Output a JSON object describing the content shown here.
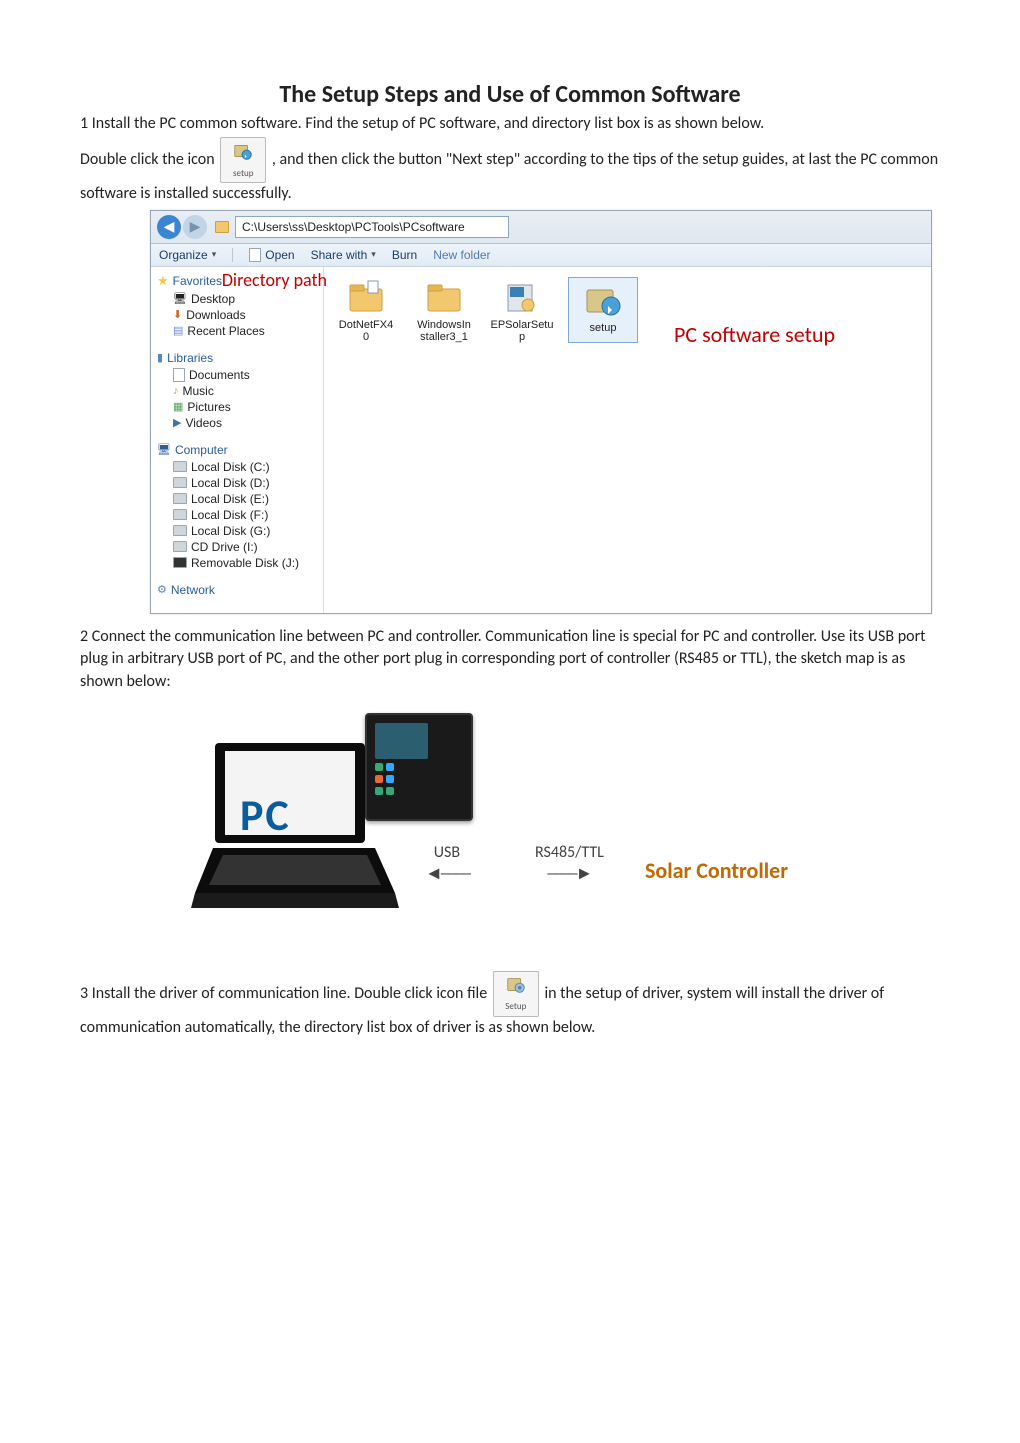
{
  "title": "The Setup Steps and Use of Common Software",
  "paragraphs": {
    "p1": "1 Install the PC common software. Find the setup of PC software, and directory list box is as shown below.",
    "p2_a": "Double click the icon",
    "p2_b": ", and then click the button \"Next step\" according to the tips of the setup guides, at last the PC common software is installed successfully.",
    "p3": "2 Connect the communication line between PC and controller. Communication line is special for PC and controller. Use its USB port plug in arbitrary USB port of PC, and the other port plug in corresponding port of controller (RS485 or TTL), the sketch map is as shown below:",
    "p4_a": "3 Install the driver of communication line. Double click icon file",
    "p4_b": "in the setup of driver, system will install the driver of communication automatically, the directory list box of driver is as shown below."
  },
  "inline_icons": {
    "setup1": "setup",
    "setup2": "Setup"
  },
  "explorer": {
    "path": "C:\\Users\\ss\\Desktop\\PCTools\\PCsoftware",
    "toolbar": {
      "organize": "Organize",
      "open": "Open",
      "sharewith": "Share with",
      "burn": "Burn",
      "newfolder": "New folder"
    },
    "annotations": {
      "dirpath": "Directory path",
      "setup": "PC software setup"
    },
    "sidebar": {
      "favorites": {
        "hdr": "Favorites",
        "items": [
          "Desktop",
          "Downloads",
          "Recent Places"
        ]
      },
      "libraries": {
        "hdr": "Libraries",
        "items": [
          "Documents",
          "Music",
          "Pictures",
          "Videos"
        ]
      },
      "computer": {
        "hdr": "Computer",
        "items": [
          "Local Disk (C:)",
          "Local Disk (D:)",
          "Local Disk (E:)",
          "Local Disk (F:)",
          "Local Disk (G:)",
          "CD Drive (I:)",
          "Removable Disk (J:)"
        ]
      },
      "network": {
        "hdr": "Network"
      }
    },
    "files": [
      {
        "line1": "DotNetFX4",
        "line2": "0"
      },
      {
        "line1": "WindowsIn",
        "line2": "staller3_1"
      },
      {
        "line1": "EPSolarSetu",
        "line2": "p"
      },
      {
        "line1": "setup",
        "line2": ""
      }
    ]
  },
  "diagram": {
    "pc": "PC",
    "usb": "USB",
    "rs": "RS485/TTL",
    "controller": "Solar Controller"
  }
}
